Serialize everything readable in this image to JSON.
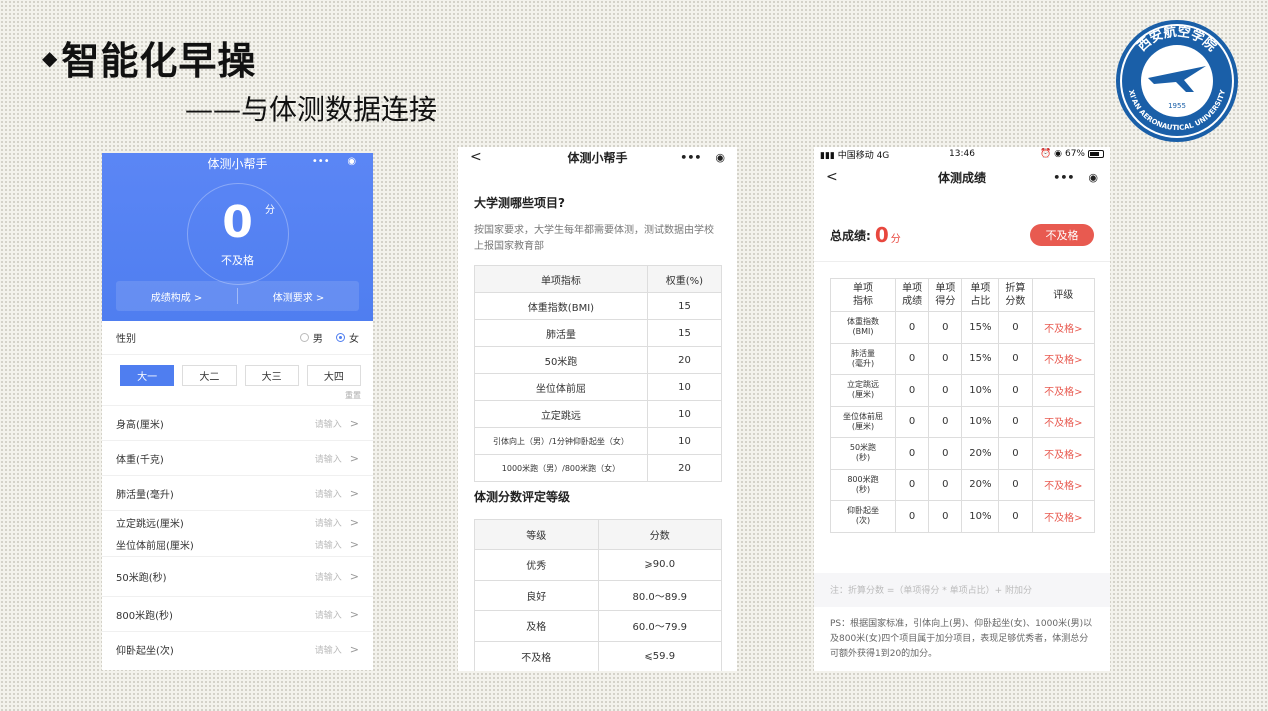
{
  "slide": {
    "bullet": "◆",
    "title": "智能化早操",
    "subtitle": "——与体测数据连接"
  },
  "logo": {
    "text_top": "西安航空学院",
    "text_bottom": "XI'AN AERONAUTICAL UNIVERSITY",
    "year": "1955",
    "color": "#1a5fa8"
  },
  "phone1": {
    "title": "体测小帮手",
    "capsule_dots": "•••",
    "capsule_circle": "◉",
    "score": "0",
    "score_unit": "分",
    "status": "不及格",
    "link_composition": "成绩构成 >",
    "link_requirements": "体测要求 >",
    "gender_label": "性别",
    "gender_male": "男",
    "gender_female": "女",
    "grades": [
      "大一",
      "大二",
      "大三",
      "大四"
    ],
    "reset": "重置",
    "placeholder": "请输入",
    "chevron": ">",
    "fields": [
      "身高(厘米)",
      "体重(千克)",
      "肺活量(毫升)",
      "立定跳远(厘米)",
      "坐位体前屈(厘米)",
      "50米跑(秒)",
      "800米跑(秒)",
      "仰卧起坐(次)"
    ],
    "accent": "#4f7ef0"
  },
  "phone2": {
    "title": "体测小帮手",
    "back": "<",
    "capsule_dots": "•••",
    "capsule_circle": "◉",
    "heading1": "大学测哪些项目?",
    "paragraph": "按国家要求，大学生每年都需要体测，测试数据由学校上报国家教育部",
    "table1_headers": [
      "单项指标",
      "权重(%)"
    ],
    "table1_rows": [
      [
        "体重指数(BMI)",
        "15"
      ],
      [
        "肺活量",
        "15"
      ],
      [
        "50米跑",
        "20"
      ],
      [
        "坐位体前屈",
        "10"
      ],
      [
        "立定跳远",
        "10"
      ],
      [
        "引体向上（男）/1分钟仰卧起坐（女）",
        "10"
      ],
      [
        "1000米跑（男）/800米跑（女）",
        "20"
      ]
    ],
    "heading2": "体测分数评定等级",
    "table2_headers": [
      "等级",
      "分数"
    ],
    "table2_rows": [
      [
        "优秀",
        "⩾90.0"
      ],
      [
        "良好",
        "80.0～89.9"
      ],
      [
        "及格",
        "60.0～79.9"
      ],
      [
        "不及格",
        "⩽59.9"
      ]
    ]
  },
  "phone3": {
    "carrier": "中国移动 4G",
    "time": "13:46",
    "battery": "67%",
    "status_icons": "⏰ ◉",
    "back": "<",
    "title": "体测成绩",
    "capsule_dots": "•••",
    "capsule_circle": "◉",
    "total_label": "总成绩:",
    "total_value": "0",
    "total_unit": "分",
    "badge": "不及格",
    "headers": [
      "单项\n指标",
      "单项\n成绩",
      "单项\n得分",
      "单项\n占比",
      "折算\n分数",
      "评级"
    ],
    "rows": [
      [
        "体重指数\n(BMI)",
        "0",
        "0",
        "15%",
        "0",
        "不及格>"
      ],
      [
        "肺活量\n(毫升)",
        "0",
        "0",
        "15%",
        "0",
        "不及格>"
      ],
      [
        "立定跳远\n(厘米)",
        "0",
        "0",
        "10%",
        "0",
        "不及格>"
      ],
      [
        "坐位体前屈\n(厘米)",
        "0",
        "0",
        "10%",
        "0",
        "不及格>"
      ],
      [
        "50米跑\n(秒)",
        "0",
        "0",
        "20%",
        "0",
        "不及格>"
      ],
      [
        "800米跑\n(秒)",
        "0",
        "0",
        "20%",
        "0",
        "不及格>"
      ],
      [
        "仰卧起坐\n(次)",
        "0",
        "0",
        "10%",
        "0",
        "不及格>"
      ]
    ],
    "note": "注：折算分数 =（单项得分 * 单项占比）+ 附加分",
    "ps": "PS：根据国家标准，引体向上(男)、仰卧起坐(女)、1000米(男)以及800米(女)四个项目属于加分项目，表现足够优秀者，体测总分可额外获得1到20的加分。",
    "danger": "#e85a50"
  }
}
